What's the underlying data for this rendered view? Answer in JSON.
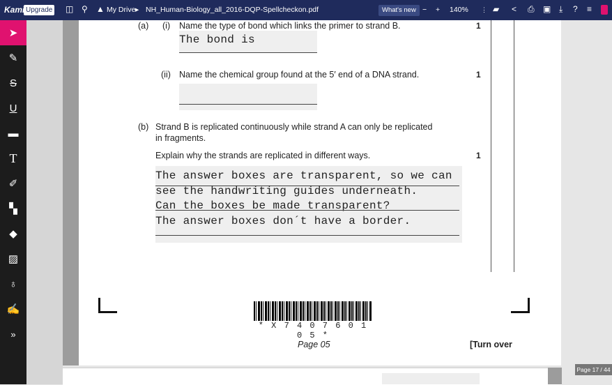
{
  "topbar": {
    "logo": "Kami",
    "upgrade_label": "Upgrade",
    "breadcrumb_root": "My Drive",
    "breadcrumb_sep": "▸",
    "filename": "NH_Human-Biology_all_2016-DQP-Spellcheckon.pdf",
    "whats_new": "What's new",
    "zoom_out": "−",
    "zoom_in": "+",
    "zoom_level": "140%"
  },
  "document": {
    "q_a_label": "(a)",
    "q_a_i_label": "(i)",
    "q_a_i_text": "Name the type of bond which links the primer to strand B.",
    "q_a_i_mark": "1",
    "q_a_i_answer": "The bond is",
    "q_a_ii_label": "(ii)",
    "q_a_ii_text": "Name the chemical group found at the 5′ end of a DNA strand.",
    "q_a_ii_mark": "1",
    "q_b_label": "(b)",
    "q_b_text_line1": "Strand B is replicated continuously while strand A can only be replicated",
    "q_b_text_line2": "in fragments.",
    "q_b_prompt": "Explain why the strands are replicated in different ways.",
    "q_b_mark": "1",
    "q_b_answer_lines": [
      "The answer boxes are transparent, so we can",
      "see the handwriting guides underneath.",
      "Can the boxes be made transparent?",
      "The answer boxes don´t have a border."
    ],
    "barcode_text": "* X 7 4 0 7 6 0 1 0 5 *",
    "page_label": "Page 05",
    "turn_over": "[Turn over"
  },
  "page_indicator": "Page 17 / 44"
}
